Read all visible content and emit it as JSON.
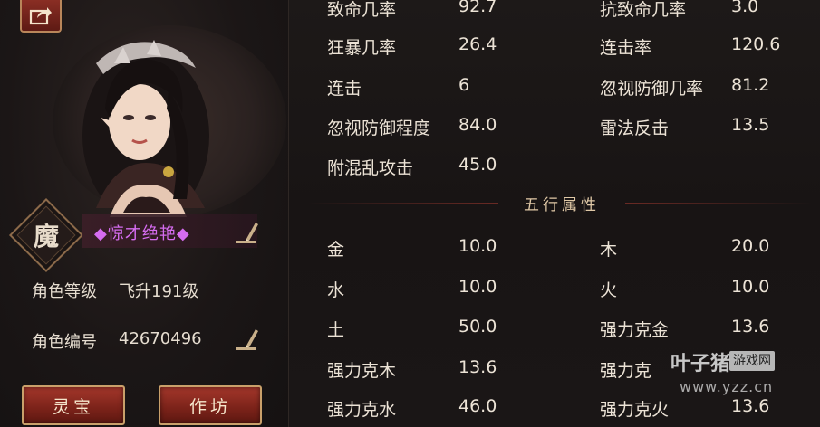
{
  "character": {
    "faction": "魔",
    "title": "◆惊才绝艳◆",
    "level_label": "角色等级",
    "level_value": "飞升191级",
    "id_label": "角色编号",
    "id_value": "42670496"
  },
  "buttons": {
    "lingbao": "灵宝",
    "zuofang": "作坊"
  },
  "stats_top": [
    {
      "label": "致命几率",
      "value": "92.7",
      "label2": "抗致命几率",
      "value2": "3.0"
    },
    {
      "label": "狂暴几率",
      "value": "26.4",
      "label2": "连击率",
      "value2": "120.6"
    },
    {
      "label": "连击",
      "value": "6",
      "label2": "忽视防御几率",
      "value2": "81.2"
    },
    {
      "label": "忽视防御程度",
      "value": "84.0",
      "label2": "雷法反击",
      "value2": "13.5"
    },
    {
      "label": "附混乱攻击",
      "value": "45.0"
    }
  ],
  "section_title": "五行属性",
  "stats_elements": [
    {
      "label": "金",
      "value": "10.0",
      "label2": "木",
      "value2": "20.0"
    },
    {
      "label": "水",
      "value": "10.0",
      "label2": "火",
      "value2": "10.0"
    },
    {
      "label": "土",
      "value": "50.0",
      "label2": "强力克金",
      "value2": "13.6"
    },
    {
      "label": "强力克木",
      "value": "13.6",
      "label2": "强力克",
      "value2": ""
    },
    {
      "label": "强力克水",
      "value": "46.0",
      "label2": "强力克火",
      "value2": "13.6"
    }
  ],
  "watermark": {
    "name": "叶子猪",
    "badge": "游戏网",
    "url": "www.yzz.cn"
  },
  "colors": {
    "title_purple": "#d56cf0",
    "button_red": "#8a2a20",
    "gold_border": "#c9a06a"
  },
  "icons": [
    "share-icon",
    "edit-icon"
  ]
}
